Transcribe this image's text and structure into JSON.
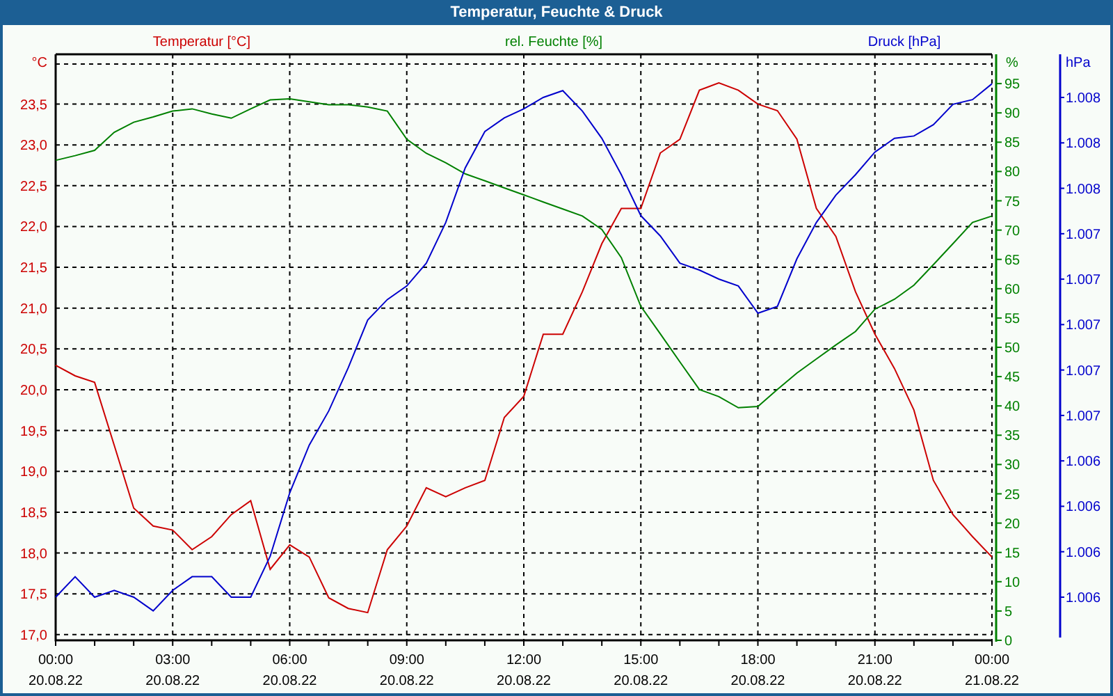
{
  "window": {
    "title": "Temperatur, Feuchte & Druck"
  },
  "plot": {
    "x_dates": [
      "20.08.22",
      "20.08.22",
      "20.08.22",
      "20.08.22",
      "20.08.22",
      "20.08.22",
      "20.08.22",
      "20.08.22",
      "21.08.22"
    ],
    "charts": [
      {
        "chart_data": {
          "type": "line",
          "title": "Temperatur [°C]",
          "ylabel": "°C",
          "grid": true,
          "x": [
            0,
            0.5,
            1,
            1.5,
            2,
            2.5,
            3,
            3.5,
            4,
            4.5,
            5,
            5.5,
            6,
            6.5,
            7,
            7.5,
            8,
            8.5,
            9,
            9.5,
            10,
            10.5,
            11,
            11.5,
            12,
            12.5,
            13,
            13.5,
            14,
            14.5,
            15,
            15.5,
            16,
            16.5,
            17,
            17.5,
            18,
            18.5,
            19,
            19.5,
            20,
            20.5,
            21,
            21.5,
            22,
            22.5,
            23,
            23.5,
            24
          ],
          "xlim": [
            0,
            24
          ],
          "ylim": [
            16.93,
            24.11
          ],
          "xticks": [
            {
              "value": 0,
              "label": "00:00"
            },
            {
              "value": 3,
              "label": "03:00"
            },
            {
              "value": 6,
              "label": "06:00"
            },
            {
              "value": 9,
              "label": "09:00"
            },
            {
              "value": 12,
              "label": "12:00"
            },
            {
              "value": 15,
              "label": "15:00"
            },
            {
              "value": 18,
              "label": "18:00"
            },
            {
              "value": 21,
              "label": "21:00"
            },
            {
              "value": 24,
              "label": "00:00"
            }
          ],
          "yticks": [
            {
              "value": 17,
              "label": "17,0"
            },
            {
              "value": 17.5,
              "label": "17,5"
            },
            {
              "value": 18,
              "label": "18,0"
            },
            {
              "value": 18.5,
              "label": "18,5"
            },
            {
              "value": 19,
              "label": "19,0"
            },
            {
              "value": 19.5,
              "label": "19,5"
            },
            {
              "value": 20,
              "label": "20,0"
            },
            {
              "value": 20.5,
              "label": "20,5"
            },
            {
              "value": 21,
              "label": "21,0"
            },
            {
              "value": 21.5,
              "label": "21,5"
            },
            {
              "value": 22,
              "label": "22,0"
            },
            {
              "value": 22.5,
              "label": "22,5"
            },
            {
              "value": 23,
              "label": "23,0"
            },
            {
              "value": 23.5,
              "label": "23,5"
            }
          ],
          "series": [
            {
              "color": "#cc0000",
              "values": [
                20.3,
                20.17,
                20.09,
                19.32,
                18.55,
                18.33,
                18.28,
                18.04,
                18.2,
                18.47,
                18.64,
                17.8,
                18.1,
                17.95,
                17.45,
                17.32,
                17.27,
                18.04,
                18.33,
                18.8,
                18.69,
                18.8,
                18.89,
                19.66,
                19.92,
                20.68,
                20.68,
                21.2,
                21.79,
                22.22,
                22.22,
                22.9,
                23.07,
                23.67,
                23.76,
                23.67,
                23.5,
                23.42,
                23.07,
                22.22,
                21.88,
                21.2,
                20.68,
                20.26,
                19.75,
                18.89,
                18.47,
                18.2,
                17.95
              ]
            }
          ]
        }
      },
      {
        "chart_data": {
          "type": "line",
          "title": "rel. Feuchte [%]",
          "ylabel": "%",
          "x": [
            0,
            0.5,
            1,
            1.5,
            2,
            2.5,
            3,
            3.5,
            4,
            4.5,
            5,
            5.5,
            6,
            6.5,
            7,
            7.5,
            8,
            8.5,
            9,
            9.5,
            10,
            10.5,
            11,
            11.5,
            12,
            12.5,
            13,
            13.5,
            14,
            14.5,
            15,
            15.5,
            16,
            16.5,
            17,
            17.5,
            18,
            18.5,
            19,
            19.5,
            20,
            20.5,
            21,
            21.5,
            22,
            22.5,
            23,
            23.5,
            24
          ],
          "xlim": [
            0,
            24
          ],
          "ylim": [
            0,
            100
          ],
          "yticks": [
            0,
            5,
            10,
            15,
            20,
            25,
            30,
            35,
            40,
            45,
            50,
            55,
            60,
            65,
            70,
            75,
            80,
            85,
            90,
            95
          ],
          "series": [
            {
              "color": "#008000",
              "values": [
                81.9,
                82.7,
                83.6,
                86.7,
                88.4,
                89.3,
                90.3,
                90.7,
                89.8,
                89.1,
                90.7,
                92.2,
                92.4,
                91.9,
                91.4,
                91.4,
                91,
                90.3,
                85.5,
                83.1,
                81.5,
                79.6,
                78.4,
                77.2,
                76,
                74.8,
                73.6,
                72.4,
                70.1,
                65.3,
                57,
                52.3,
                47.5,
                42.8,
                41.6,
                39.7,
                39.9,
                42.8,
                45.6,
                48,
                50.4,
                52.7,
                56.5,
                58.2,
                60.6,
                64.1,
                67.7,
                71.3,
                72.4
              ]
            }
          ]
        }
      },
      {
        "chart_data": {
          "type": "line",
          "title": "Druck [hPa]",
          "ylabel": "hPa",
          "x": [
            0,
            0.5,
            1,
            1.5,
            2,
            2.5,
            3,
            3.5,
            4,
            4.5,
            5,
            5.5,
            6,
            6.5,
            7,
            7.5,
            8,
            8.5,
            9,
            9.5,
            10,
            10.5,
            11,
            11.5,
            12,
            12.5,
            13,
            13.5,
            14,
            14.5,
            15,
            15.5,
            16,
            16.5,
            17,
            17.5,
            18,
            18.5,
            19,
            19.5,
            20,
            20.5,
            21,
            21.5,
            22,
            22.5,
            23,
            23.5,
            24
          ],
          "xlim": [
            0,
            24
          ],
          "ylim": [
            1005.56,
            1008.14
          ],
          "yticks": [
            {
              "value": 1007.95,
              "label": "1.008"
            },
            {
              "value": 1007.75,
              "label": "1.008"
            },
            {
              "value": 1007.55,
              "label": "1.008"
            },
            {
              "value": 1007.35,
              "label": "1.007"
            },
            {
              "value": 1007.15,
              "label": "1.007"
            },
            {
              "value": 1006.95,
              "label": "1.007"
            },
            {
              "value": 1006.75,
              "label": "1.007"
            },
            {
              "value": 1006.55,
              "label": "1.007"
            },
            {
              "value": 1006.35,
              "label": "1.006"
            },
            {
              "value": 1006.15,
              "label": "1.006"
            },
            {
              "value": 1005.95,
              "label": "1.006"
            },
            {
              "value": 1005.75,
              "label": "1.006"
            }
          ],
          "series": [
            {
              "color": "#0000cc",
              "values": [
                1005.75,
                1005.84,
                1005.75,
                1005.78,
                1005.75,
                1005.69,
                1005.78,
                1005.84,
                1005.84,
                1005.75,
                1005.75,
                1005.93,
                1006.21,
                1006.42,
                1006.57,
                1006.76,
                1006.97,
                1007.06,
                1007.12,
                1007.22,
                1007.4,
                1007.64,
                1007.8,
                1007.86,
                1007.9,
                1007.95,
                1007.98,
                1007.89,
                1007.77,
                1007.61,
                1007.43,
                1007.34,
                1007.22,
                1007.19,
                1007.15,
                1007.12,
                1007,
                1007.03,
                1007.24,
                1007.4,
                1007.52,
                1007.61,
                1007.71,
                1007.77,
                1007.78,
                1007.83,
                1007.92,
                1007.94,
                1008.01
              ]
            }
          ]
        }
      }
    ]
  }
}
